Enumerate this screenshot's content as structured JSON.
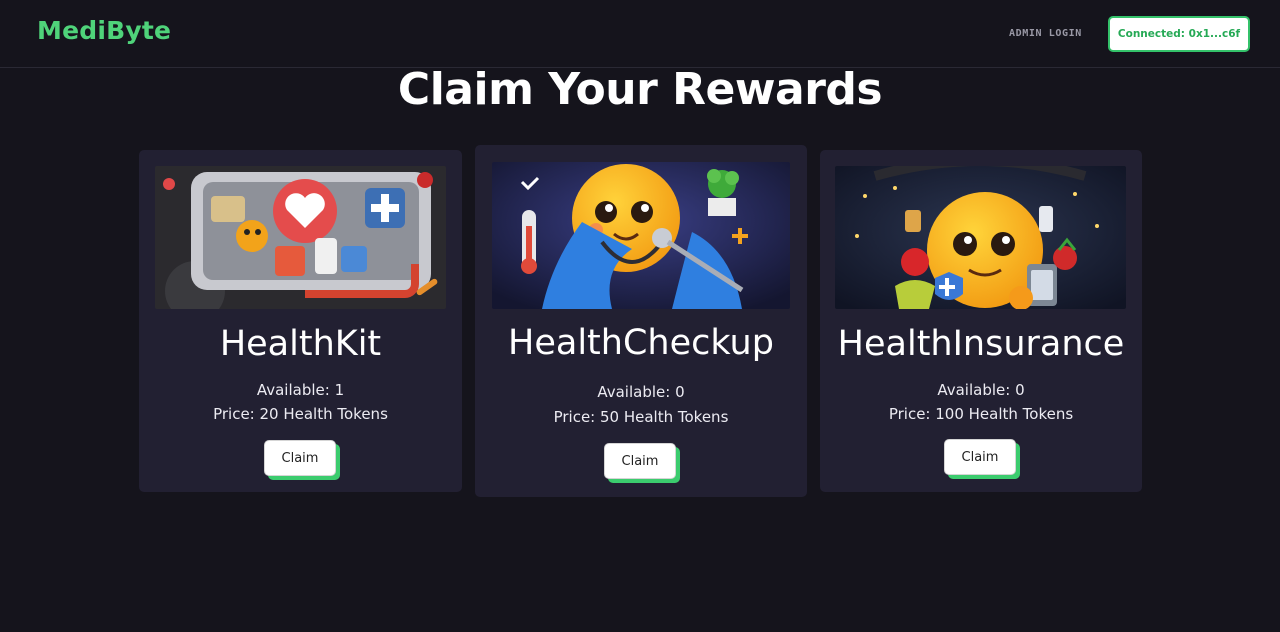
{
  "header": {
    "logo": "MediByte",
    "admin_login": "ADMIN LOGIN",
    "wallet_status": "Connected: 0x1...c6f"
  },
  "main": {
    "title": "Claim Your Rewards"
  },
  "rewards": [
    {
      "name": "HealthKit",
      "available": "Available: 1",
      "price": "Price: 20 Health Tokens",
      "claim_label": "Claim"
    },
    {
      "name": "HealthCheckup",
      "available": "Available: 0",
      "price": "Price: 50 Health Tokens",
      "claim_label": "Claim"
    },
    {
      "name": "HealthInsurance",
      "available": "Available: 0",
      "price": "Price: 100 Health Tokens",
      "claim_label": "Claim"
    }
  ],
  "colors": {
    "background": "#15141c",
    "card": "#222032",
    "accent": "#4fd37a"
  }
}
